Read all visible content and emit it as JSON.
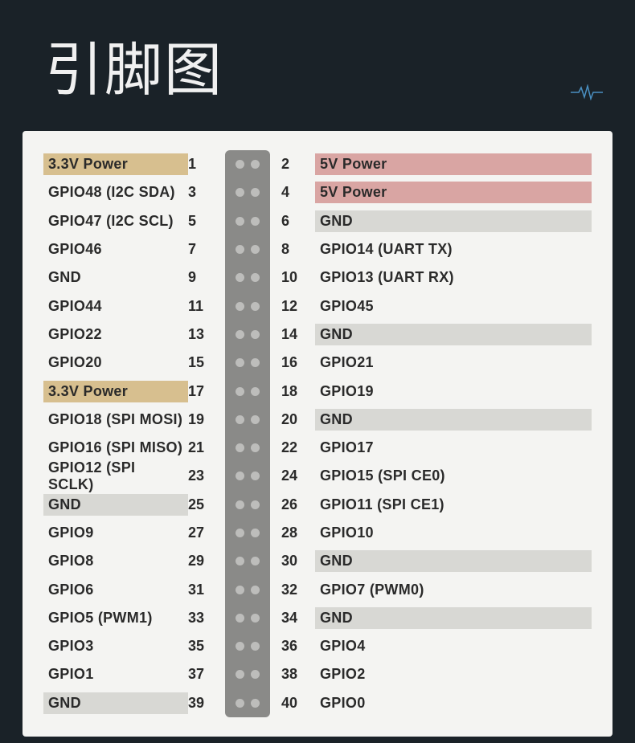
{
  "title": "引脚图",
  "colors": {
    "background": "#1a2228",
    "panel": "#f4f4f2",
    "strip": "#8a8a88",
    "dot": "#bdbdbb",
    "highlight_gold": "#d7bf8f",
    "highlight_rose": "#d9a5a3",
    "highlight_gray": "#d8d8d4"
  },
  "pins": [
    {
      "left": {
        "label": "3.3V Power",
        "hl": "gold"
      },
      "ln": "1",
      "rn": "2",
      "right": {
        "label": "5V Power",
        "hl": "rose"
      }
    },
    {
      "left": {
        "label": "GPIO48 (I2C SDA)"
      },
      "ln": "3",
      "rn": "4",
      "right": {
        "label": "5V Power",
        "hl": "rose"
      }
    },
    {
      "left": {
        "label": "GPIO47 (I2C SCL)"
      },
      "ln": "5",
      "rn": "6",
      "right": {
        "label": "GND",
        "hl": "gray"
      }
    },
    {
      "left": {
        "label": "GPIO46"
      },
      "ln": "7",
      "rn": "8",
      "right": {
        "label": "GPIO14 (UART TX)"
      }
    },
    {
      "left": {
        "label": "GND"
      },
      "ln": "9",
      "rn": "10",
      "right": {
        "label": "GPIO13 (UART RX)"
      }
    },
    {
      "left": {
        "label": "GPIO44"
      },
      "ln": "11",
      "rn": "12",
      "right": {
        "label": "GPIO45"
      }
    },
    {
      "left": {
        "label": "GPIO22"
      },
      "ln": "13",
      "rn": "14",
      "right": {
        "label": "GND",
        "hl": "gray"
      }
    },
    {
      "left": {
        "label": "GPIO20"
      },
      "ln": "15",
      "rn": "16",
      "right": {
        "label": "GPIO21"
      }
    },
    {
      "left": {
        "label": "3.3V Power",
        "hl": "gold"
      },
      "ln": "17",
      "rn": "18",
      "right": {
        "label": "GPIO19"
      }
    },
    {
      "left": {
        "label": "GPIO18 (SPI MOSI)"
      },
      "ln": "19",
      "rn": "20",
      "right": {
        "label": "GND",
        "hl": "gray"
      }
    },
    {
      "left": {
        "label": "GPIO16 (SPI MISO)"
      },
      "ln": "21",
      "rn": "22",
      "right": {
        "label": "GPIO17"
      }
    },
    {
      "left": {
        "label": "GPIO12 (SPI SCLK)"
      },
      "ln": "23",
      "rn": "24",
      "right": {
        "label": "GPIO15 (SPI CE0)"
      }
    },
    {
      "left": {
        "label": "GND",
        "hl": "gray"
      },
      "ln": "25",
      "rn": "26",
      "right": {
        "label": "GPIO11 (SPI CE1)"
      }
    },
    {
      "left": {
        "label": "GPIO9"
      },
      "ln": "27",
      "rn": "28",
      "right": {
        "label": "GPIO10"
      }
    },
    {
      "left": {
        "label": "GPIO8"
      },
      "ln": "29",
      "rn": "30",
      "right": {
        "label": "GND",
        "hl": "gray"
      }
    },
    {
      "left": {
        "label": "GPIO6"
      },
      "ln": "31",
      "rn": "32",
      "right": {
        "label": "GPIO7 (PWM0)"
      }
    },
    {
      "left": {
        "label": "GPIO5 (PWM1)"
      },
      "ln": "33",
      "rn": "34",
      "right": {
        "label": "GND",
        "hl": "gray"
      }
    },
    {
      "left": {
        "label": "GPIO3"
      },
      "ln": "35",
      "rn": "36",
      "right": {
        "label": "GPIO4"
      }
    },
    {
      "left": {
        "label": "GPIO1"
      },
      "ln": "37",
      "rn": "38",
      "right": {
        "label": "GPIO2"
      }
    },
    {
      "left": {
        "label": "GND",
        "hl": "gray"
      },
      "ln": "39",
      "rn": "40",
      "right": {
        "label": "GPIO0"
      }
    }
  ]
}
